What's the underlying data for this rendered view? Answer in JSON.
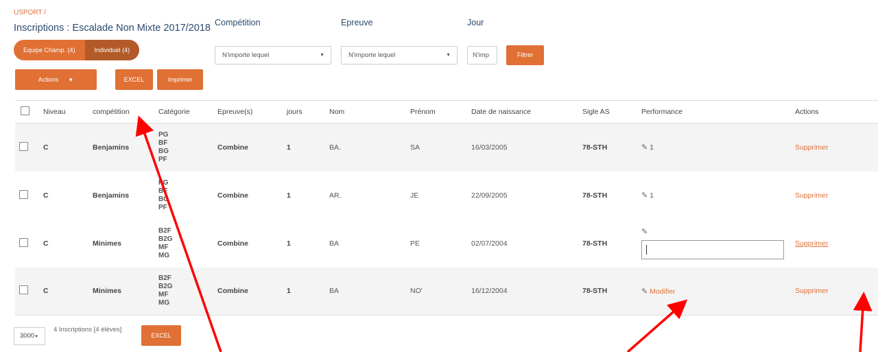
{
  "breadcrumb": "USPORT /",
  "title": "Inscriptions : Escalade Non Mixte 2017/2018",
  "segments": {
    "team": "Equipe Champ. (4)",
    "individual": "Individuel (4)"
  },
  "filters": {
    "competition_label": "Compétition",
    "competition_value": "N'importe lequel",
    "epreuve_label": "Epreuve",
    "epreuve_value": "N'importe lequel",
    "jour_label": "Jour",
    "jour_value": "N'imp",
    "filter_button": "Filtrer"
  },
  "toolbar": {
    "actions": "Actions",
    "excel": "EXCEL",
    "print": "Imprimer"
  },
  "table": {
    "headers": [
      "Niveau",
      "compétition",
      "Catégorie",
      "Epreuve(s)",
      "jours",
      "Nom",
      "Prénom",
      "Date de naissance",
      "Sigle AS",
      "Performance",
      "Actions"
    ],
    "rows": [
      {
        "niveau": "C",
        "competition": "Benjamins",
        "categories": [
          "PG",
          "BF",
          "BG",
          "PF"
        ],
        "epreuve": "Combine",
        "jours": "1",
        "nom": "BA.",
        "prenom": "SA",
        "naissance": "16/03/2005",
        "sigle": "78-STH",
        "perf_icon": "✎",
        "perf": "1",
        "action": "Supprimer"
      },
      {
        "niveau": "C",
        "competition": "Benjamins",
        "categories": [
          "PG",
          "BF",
          "BG",
          "PF"
        ],
        "epreuve": "Combine",
        "jours": "1",
        "nom": "AR.",
        "prenom": "JE",
        "naissance": "22/09/2005",
        "sigle": "78-STH",
        "perf_icon": "✎",
        "perf": "1",
        "action": "Supprimer"
      },
      {
        "niveau": "C",
        "competition": "Minimes",
        "categories": [
          "B2F",
          "B2G",
          "MF",
          "MG"
        ],
        "epreuve": "Combine",
        "jours": "1",
        "nom": "BA",
        "prenom": "PE",
        "naissance": "02/07/2004",
        "sigle": "78-STH",
        "perf_icon": "✎",
        "perf": "",
        "action": "Supprimer"
      },
      {
        "niveau": "C",
        "competition": "Minimes",
        "categories": [
          "B2F",
          "B2G",
          "MF",
          "MG"
        ],
        "epreuve": "Combine",
        "jours": "1",
        "nom": "BA",
        "prenom": "NO'",
        "naissance": "16/12/2004",
        "sigle": "78-STH",
        "perf_icon": "✎",
        "perf": "Modifier",
        "action": "Supprimer"
      }
    ]
  },
  "footer": {
    "page_size": "3000",
    "summary": "4 Inscriptions [4 élèves]",
    "excel": "EXCEL"
  },
  "colors": {
    "accent": "#e07034",
    "title": "#2c4b6e",
    "annotation_arrow": "#ff0000"
  }
}
